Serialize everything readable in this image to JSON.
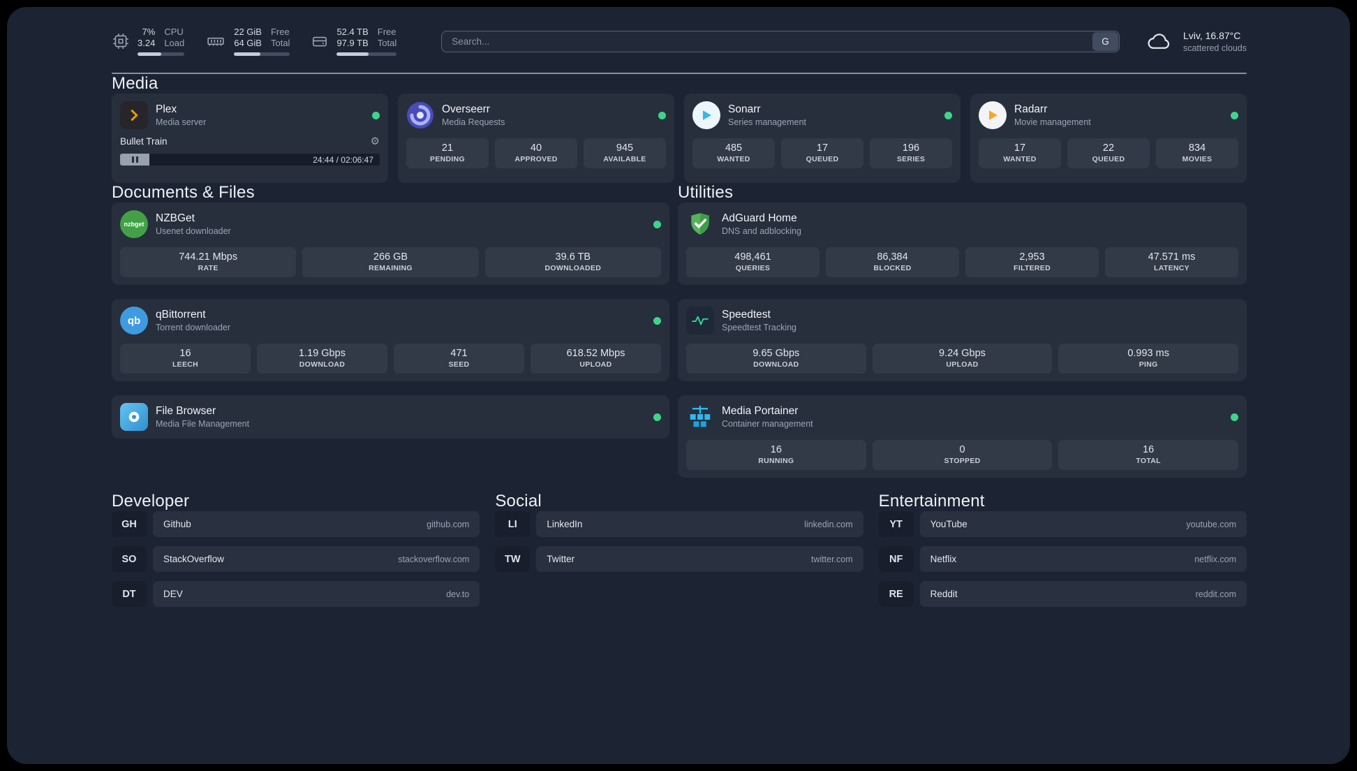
{
  "colors": {
    "status_online": "#3ed48c",
    "accent_green": "#34d399",
    "plex_amber": "#e5a00d",
    "background": "#1c2433"
  },
  "icons": {
    "gear": "⚙"
  },
  "topbar": {
    "cpu": {
      "values": [
        "7%",
        "3.24"
      ],
      "labels": [
        "CPU",
        "Load"
      ],
      "bar_percent": 50
    },
    "memory": {
      "values": [
        "22 GiB",
        "64 GiB"
      ],
      "labels": [
        "Free",
        "Total"
      ],
      "bar_percent": 47
    },
    "disk": {
      "values": [
        "52.4 TB",
        "97.9 TB"
      ],
      "labels": [
        "Free",
        "Total"
      ],
      "bar_percent": 53
    },
    "search": {
      "placeholder": "Search...",
      "provider_button": "G"
    },
    "weather": {
      "location": "Lviv, 16.87°C",
      "condition": "scattered clouds"
    }
  },
  "sections": {
    "media": {
      "heading": "Media",
      "plex": {
        "name": "Plex",
        "desc": "Media server",
        "now_playing": "Bullet Train",
        "time": "24:44 / 02:06:47"
      },
      "overseerr": {
        "name": "Overseerr",
        "desc": "Media Requests",
        "stats": [
          {
            "value": "21",
            "label": "PENDING"
          },
          {
            "value": "40",
            "label": "APPROVED"
          },
          {
            "value": "945",
            "label": "AVAILABLE"
          }
        ]
      },
      "sonarr": {
        "name": "Sonarr",
        "desc": "Series management",
        "stats": [
          {
            "value": "485",
            "label": "WANTED"
          },
          {
            "value": "17",
            "label": "QUEUED"
          },
          {
            "value": "196",
            "label": "SERIES"
          }
        ]
      },
      "radarr": {
        "name": "Radarr",
        "desc": "Movie management",
        "stats": [
          {
            "value": "17",
            "label": "WANTED"
          },
          {
            "value": "22",
            "label": "QUEUED"
          },
          {
            "value": "834",
            "label": "MOVIES"
          }
        ]
      }
    },
    "documents": {
      "heading": "Documents & Files",
      "nzbget": {
        "name": "NZBGet",
        "desc": "Usenet downloader",
        "icon_text": "nzbget",
        "stats": [
          {
            "value": "744.21 Mbps",
            "label": "RATE"
          },
          {
            "value": "266 GB",
            "label": "REMAINING"
          },
          {
            "value": "39.6 TB",
            "label": "DOWNLOADED"
          }
        ]
      },
      "qbittorrent": {
        "name": "qBittorrent",
        "desc": "Torrent downloader",
        "icon_text": "qb",
        "stats": [
          {
            "value": "16",
            "label": "LEECH"
          },
          {
            "value": "1.19 Gbps",
            "label": "DOWNLOAD"
          },
          {
            "value": "471",
            "label": "SEED"
          },
          {
            "value": "618.52 Mbps",
            "label": "UPLOAD"
          }
        ]
      },
      "filebrowser": {
        "name": "File Browser",
        "desc": "Media File Management"
      }
    },
    "utilities": {
      "heading": "Utilities",
      "adguard": {
        "name": "AdGuard Home",
        "desc": "DNS and adblocking",
        "stats": [
          {
            "value": "498,461",
            "label": "QUERIES"
          },
          {
            "value": "86,384",
            "label": "BLOCKED"
          },
          {
            "value": "2,953",
            "label": "FILTERED"
          },
          {
            "value": "47.571 ms",
            "label": "LATENCY"
          }
        ]
      },
      "speedtest": {
        "name": "Speedtest",
        "desc": "Speedtest Tracking",
        "stats": [
          {
            "value": "9.65 Gbps",
            "label": "DOWNLOAD"
          },
          {
            "value": "9.24 Gbps",
            "label": "UPLOAD"
          },
          {
            "value": "0.993 ms",
            "label": "PING"
          }
        ]
      },
      "portainer": {
        "name": "Media Portainer",
        "desc": "Container management",
        "stats": [
          {
            "value": "16",
            "label": "RUNNING"
          },
          {
            "value": "0",
            "label": "STOPPED"
          },
          {
            "value": "16",
            "label": "TOTAL"
          }
        ]
      }
    }
  },
  "bookmarks": {
    "developer": {
      "heading": "Developer",
      "items": [
        {
          "abbr": "GH",
          "name": "Github",
          "url": "github.com"
        },
        {
          "abbr": "SO",
          "name": "StackOverflow",
          "url": "stackoverflow.com"
        },
        {
          "abbr": "DT",
          "name": "DEV",
          "url": "dev.to"
        }
      ]
    },
    "social": {
      "heading": "Social",
      "items": [
        {
          "abbr": "LI",
          "name": "LinkedIn",
          "url": "linkedin.com"
        },
        {
          "abbr": "TW",
          "name": "Twitter",
          "url": "twitter.com"
        }
      ]
    },
    "entertainment": {
      "heading": "Entertainment",
      "items": [
        {
          "abbr": "YT",
          "name": "YouTube",
          "url": "youtube.com"
        },
        {
          "abbr": "NF",
          "name": "Netflix",
          "url": "netflix.com"
        },
        {
          "abbr": "RE",
          "name": "Reddit",
          "url": "reddit.com"
        }
      ]
    }
  }
}
